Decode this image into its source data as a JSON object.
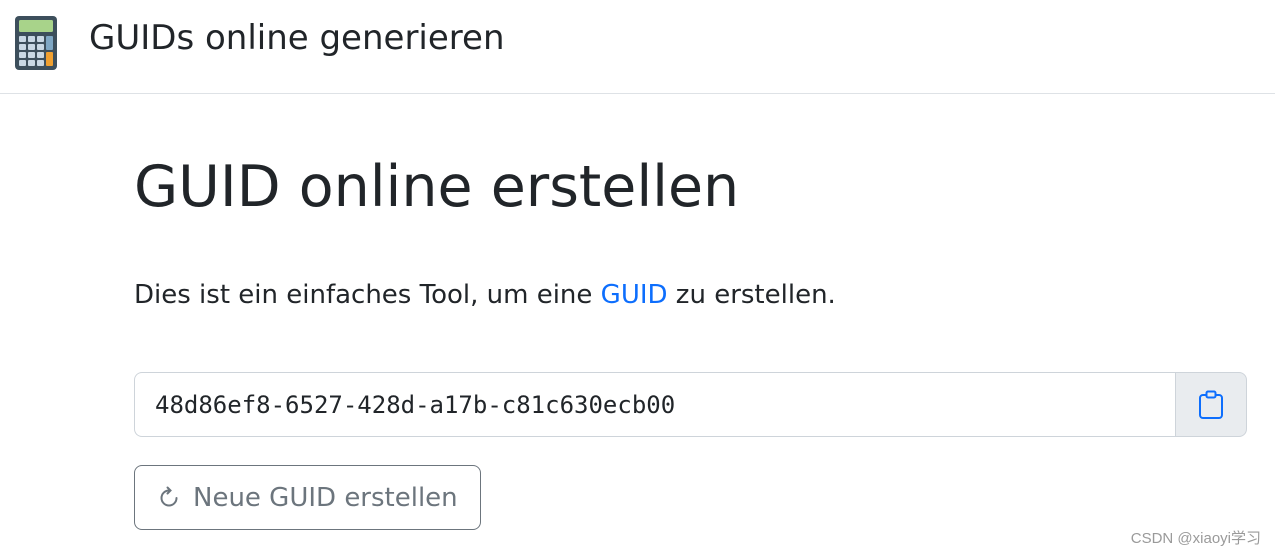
{
  "header": {
    "app_title": "GUIDs online generieren",
    "brand_icon": "calculator-icon"
  },
  "main": {
    "heading": "GUID online erstellen",
    "intro": {
      "before": "Dies ist ein einfaches Tool, um eine ",
      "link_text": "GUID",
      "after": " zu erstellen."
    },
    "guid_value": "48d86ef8-6527-428d-a17b-c81c630ecb00",
    "copy_icon": "clipboard-icon",
    "new_button_label": "Neue GUID erstellen",
    "new_button_icon": "refresh-icon"
  },
  "watermark": "CSDN @xiaoyi学习",
  "colors": {
    "link": "#0d6efd",
    "text": "#212529",
    "muted": "#6c757d",
    "border": "#ced4da",
    "addon_bg": "#e9ecef"
  }
}
